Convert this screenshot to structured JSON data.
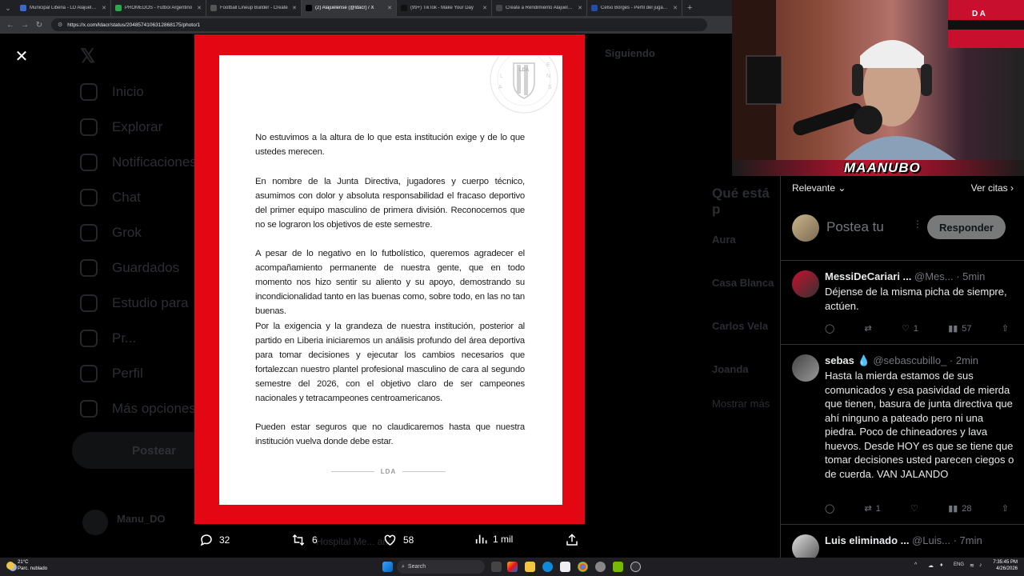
{
  "browser": {
    "tabs": [
      {
        "title": "Municipal Liberia - LD Alajuelense",
        "color": "#3a6ad1",
        "active": false
      },
      {
        "title": "PROMEDOS - Futbol Argentino",
        "color": "#2aa84a",
        "active": false
      },
      {
        "title": "Football Lineup Builder - Create",
        "color": "#555555",
        "active": false
      },
      {
        "title": "(2) Alajuelense (@ldacr) / X",
        "color": "#000000",
        "active": true
      },
      {
        "title": "(99+) TikTok - Make Your Day",
        "color": "#111111",
        "active": false
      },
      {
        "title": "Create a Rendimiento Alajuelense",
        "color": "#444444",
        "active": false
      },
      {
        "title": "Celso Borges - Perfil del jugador",
        "color": "#1f4fa8",
        "active": false
      }
    ],
    "url": "https://x.com/ldacr/status/2048574106312868175/photo/1"
  },
  "x_nav": {
    "items": [
      "Inicio",
      "Explorar",
      "Notificaciones",
      "Chat",
      "Grok",
      "Guardados",
      "Estudio para",
      "Pr...",
      "Perfil",
      "Más opciones"
    ],
    "post_label": "Postear",
    "profile_name": "Manu_DO",
    "following_label": "Siguiendo"
  },
  "right_dim": {
    "title": "Qué está p",
    "trends": [
      "Aura",
      "Casa Blanca",
      "Carlos Vela",
      "Joanda"
    ],
    "show_more": "Mostrar más"
  },
  "statement": {
    "seal_text": "ALAJUELENSE",
    "seal_letters": "LDA",
    "paragraphs": [
      "No estuvimos a la altura de lo que esta institución exige y de lo que ustedes merecen.",
      "En nombre de la Junta Directiva, jugadores y cuerpo técnico, asumimos con dolor y absoluta responsabilidad el fracaso deportivo del primer equipo masculino de primera división. Reconocemos que no se lograron los objetivos de este semestre.",
      "A pesar de lo negativo en lo futbolístico, queremos agradecer el acompañamiento permanente de nuestra gente, que en todo momento nos hizo sentir su aliento y su apoyo, demostrando su incondicionalidad tanto en las buenas como, sobre todo, en las no tan buenas.",
      "Por la exigencia y la grandeza de nuestra institución, posterior al partido en Liberia iniciaremos un análisis profundo del área deportiva para tomar decisiones y ejecutar los cambios necesarios que fortalezcan nuestro plantel profesional masculino de cara al segundo semestre del 2026, con el objetivo claro de ser campeones nacionales y tetracampeones centroamericanos.",
      "Pueden estar seguros que no claudicaremos hasta que nuestra institución vuelva donde debe estar."
    ],
    "footer": "LDA"
  },
  "actions": {
    "replies": "32",
    "reposts": "6",
    "likes": "58",
    "views": "1 mil",
    "behind_text": "Hospital Me... ano"
  },
  "replies_panel": {
    "sort_label": "Relevante ⌄",
    "citas_label": "Ver citas ›",
    "compose_placeholder": "Postea tu",
    "reply_button": "Responder",
    "replies": [
      {
        "name": "MessiDeCariari ...",
        "handle": "@Mes...",
        "time": "· 5min",
        "text": "Déjense de la misma picha de siempre, actúen.",
        "stats": {
          "replies": "",
          "reposts": "",
          "likes": "1",
          "views": "57"
        }
      },
      {
        "name": "sebas",
        "handle": "@sebascubillo_",
        "time": "· 2min",
        "text": "Hasta la mierda estamos de sus comunicados y esa pasividad de mierda que tienen, basura de junta directiva que ahí ninguno a pateado pero ni una piedra. Poco de chineadores y lava huevos. Desde HOY es que se tiene que tomar decisiones usted parecen ciegos o de cuerda. VAN JALANDO",
        "stats": {
          "replies": "",
          "reposts": "1",
          "likes": "",
          "views": "28"
        }
      },
      {
        "name": "Luis eliminado ...",
        "handle": "@Luis...",
        "time": "· 7min",
        "text": "",
        "stats": {
          "replies": "",
          "reposts": "",
          "likes": "",
          "views": ""
        }
      }
    ]
  },
  "webcam": {
    "streamer_name": "MAANUBO",
    "flag_text": "D A"
  },
  "taskbar": {
    "temp": "21°C",
    "weather": "Parc. nublado",
    "search": "Search",
    "lang": "ENG",
    "time": "7:35:45 PM",
    "date": "4/26/2026"
  },
  "colors": {
    "photo_red": "#e30613",
    "x_bg": "#000000",
    "text_gray": "#71767b"
  }
}
